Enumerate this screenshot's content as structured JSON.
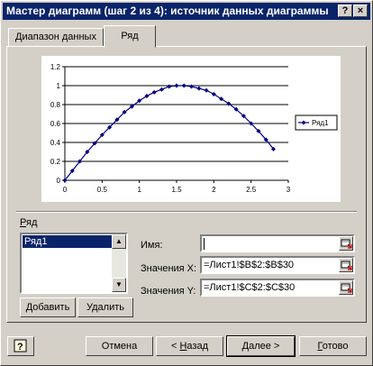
{
  "window": {
    "title": "Мастер диаграмм (шаг 2 из 4): источник данных диаграммы",
    "help_label": "?",
    "close_label": "×"
  },
  "tabs": [
    {
      "label": "Диапазон данных",
      "active": false
    },
    {
      "label": "Ряд",
      "active": true
    }
  ],
  "chart_data": {
    "type": "line",
    "x_ticks": [
      "0",
      "0.5",
      "1",
      "1.5",
      "2",
      "2.5",
      "3"
    ],
    "y_ticks": [
      "0",
      "0.2",
      "0.4",
      "0.6",
      "0.8",
      "1",
      "1.2"
    ],
    "xlim": [
      0,
      3
    ],
    "ylim": [
      0,
      1.2
    ],
    "grid": "horizontal",
    "legend_position": "right",
    "series": [
      {
        "name": "Ряд1",
        "color": "#000080",
        "x": [
          0,
          0.1,
          0.2,
          0.3,
          0.4,
          0.5,
          0.6,
          0.7,
          0.8,
          0.9,
          1.0,
          1.1,
          1.2,
          1.3,
          1.4,
          1.5,
          1.6,
          1.7,
          1.8,
          1.9,
          2.0,
          2.1,
          2.2,
          2.3,
          2.4,
          2.5,
          2.6,
          2.7,
          2.8
        ],
        "y": [
          0,
          0.1,
          0.2,
          0.3,
          0.39,
          0.48,
          0.56,
          0.64,
          0.72,
          0.78,
          0.84,
          0.89,
          0.93,
          0.96,
          0.99,
          1.0,
          1.0,
          0.99,
          0.97,
          0.95,
          0.91,
          0.86,
          0.81,
          0.75,
          0.68,
          0.6,
          0.52,
          0.43,
          0.33
        ]
      }
    ]
  },
  "series_section": {
    "title": "Ряд",
    "items": [
      "Ряд1"
    ],
    "add_button": "Добавить",
    "remove_button": "Удалить"
  },
  "fields": {
    "name_label": "Имя:",
    "name_value": "",
    "x_label": "Значения X:",
    "x_value": "=Лист1!$B$2:$B$30",
    "y_label": "Значения Y:",
    "y_value": "=Лист1!$C$2:$C$30"
  },
  "buttons": {
    "cancel": "Отмена",
    "back": "< Назад",
    "next": "Далее >",
    "finish": "Готово"
  }
}
